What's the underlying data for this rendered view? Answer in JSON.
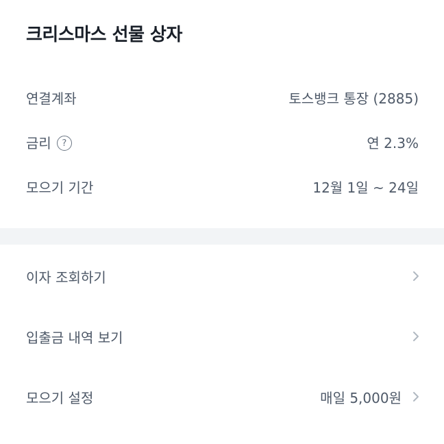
{
  "header": {
    "title": "크리스마스 선물 상자"
  },
  "info": {
    "account_label": "연결계좌",
    "account_value": "토스뱅크 통장 (2885)",
    "rate_label": "금리",
    "rate_help_symbol": "?",
    "rate_value": "연 2.3%",
    "period_label": "모으기 기간",
    "period_value": "12월 1일 ~ 24일"
  },
  "menu": {
    "interest_label": "이자 조회하기",
    "history_label": "입출금 내역 보기",
    "settings_label": "모으기 설정",
    "settings_value": "매일 5,000원"
  },
  "icons": {
    "help": "question-circle-icon",
    "chevron": "chevron-right-icon"
  },
  "colors": {
    "title": "#191f28",
    "text": "#4e5968",
    "divider": "#f2f4f6",
    "chevron": "#b0b8c1"
  }
}
